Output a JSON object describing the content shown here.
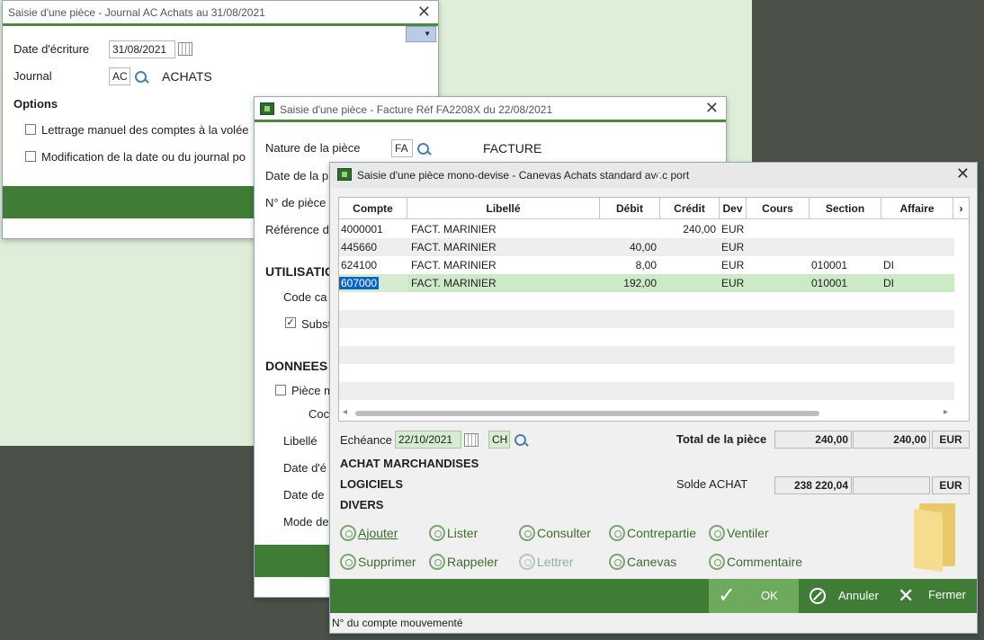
{
  "win1": {
    "title": "Saisie d'une pièce - Journal AC Achats au 31/08/2021",
    "date_label": "Date d'écriture",
    "date_value": "31/08/2021",
    "journal_label": "Journal",
    "journal_code": "AC",
    "journal_name": "ACHATS",
    "options_label": "Options",
    "opt1": "Lettrage manuel des comptes à la volée",
    "opt2": "Modification de la date ou du journal po"
  },
  "win2": {
    "title": "Saisie d'une pièce - Facture Réf FA2208X du 22/08/2021",
    "nature_label": "Nature de la pièce",
    "nature_code": "FA",
    "nature_name": "FACTURE",
    "date_label": "Date de la p",
    "num_label": "N° de pièce",
    "ref_label": "Référence d",
    "utilisation": "UTILISATIO",
    "code_label": "Code ca",
    "subst_label": "Subst",
    "donnees": "DONNEES",
    "piece_label": "Pièce m",
    "cod_label": "Coc",
    "libelle_label": "Libellé",
    "date_e_label": "Date d'é",
    "date_de_label": "Date de",
    "mode_label": "Mode de"
  },
  "win3": {
    "title": "Saisie d'une pièce mono-devise - Canevas Achats standard avec port",
    "columns": [
      "Compte",
      "Libellé",
      "Débit",
      "Crédit",
      "Dev",
      "Cours",
      "Section",
      "Affaire"
    ],
    "rows": [
      {
        "compte": "4000001",
        "libelle": "FACT. MARINIER",
        "debit": "",
        "credit": "240,00",
        "dev": "EUR",
        "cours": "",
        "section": "",
        "affaire": ""
      },
      {
        "compte": "445660",
        "libelle": "FACT. MARINIER",
        "debit": "40,00",
        "credit": "",
        "dev": "EUR",
        "cours": "",
        "section": "",
        "affaire": ""
      },
      {
        "compte": "624100",
        "libelle": "FACT. MARINIER",
        "debit": "8,00",
        "credit": "",
        "dev": "EUR",
        "cours": "",
        "section": "010001",
        "affaire": "DI"
      },
      {
        "compte": "607000",
        "libelle": "FACT. MARINIER",
        "debit": "192,00",
        "credit": "",
        "dev": "EUR",
        "cours": "",
        "section": "010001",
        "affaire": "DI"
      }
    ],
    "echeance_label": "Echéance",
    "echeance_value": "22/10/2021",
    "echeance_mode": "CH",
    "total_label": "Total de la pièce",
    "total_debit": "240,00",
    "total_credit": "240,00",
    "total_dev": "EUR",
    "solde_label": "Solde ACHAT",
    "solde_value": "238 220,04",
    "solde_dev": "EUR",
    "info1": "ACHAT MARCHANDISES",
    "info2": "LOGICIELS",
    "info3": "DIVERS",
    "actions": [
      "Ajouter",
      "Lister",
      "Consulter",
      "Contrepartie",
      "Ventiler",
      "Supprimer",
      "Rappeler",
      "Lettrer",
      "Canevas",
      "Commentaire"
    ],
    "ok": "OK",
    "annuler": "Annuler",
    "fermer": "Fermer",
    "status": "N° du compte mouvementé"
  },
  "colors": {
    "accent": "#3f7d37",
    "selected_row": "#cdeac7",
    "selection": "#0a64c8"
  }
}
